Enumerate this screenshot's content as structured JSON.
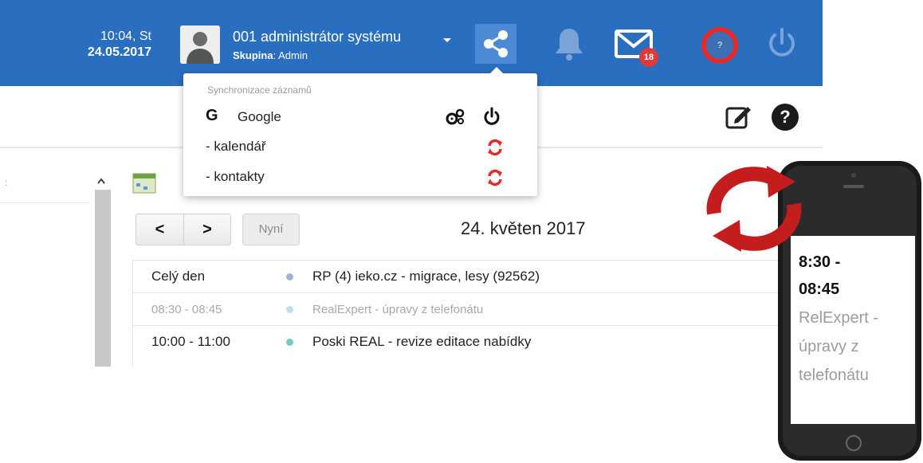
{
  "header": {
    "time": "10:04, St",
    "date": "24.05.2017",
    "user_name": "001 administrátor systému",
    "group_label": "Skupina",
    "group_value": ": Admin",
    "mail_count": "18",
    "help_glyph": "?",
    "icons": [
      "avatar",
      "chevron-down-icon",
      "share-icon",
      "bell-icon",
      "mail-icon",
      "help-icon",
      "power-icon"
    ]
  },
  "toolbar": {
    "icons": [
      "edit-icon",
      "question-circle-icon"
    ],
    "help_glyph": "?"
  },
  "sync_menu": {
    "heading": "Synchronizace záznamů",
    "provider_letter": "G",
    "provider_name": "Google",
    "items": [
      {
        "label": "- kalendář"
      },
      {
        "label": "- kontakty"
      }
    ],
    "accent_color": "#e52a2a"
  },
  "calendar": {
    "prev_label": "<",
    "next_label": ">",
    "now_label": "Nyní",
    "current_date": "24. květen 2017",
    "events": [
      {
        "time": "Celý den",
        "title": "RP (4) ieko.cz - migrace, lesy (92562)",
        "dot_color": "#9bb3d6"
      },
      {
        "time": "08:30 - 08:45",
        "title": "RealExpert - úpravy z telefonátu",
        "dot_color": "#b9e1e6"
      },
      {
        "time": "10:00 - 11:00",
        "title": "Poski REAL - revize editace nabídky",
        "dot_color": "#72c9c9"
      }
    ]
  },
  "phone": {
    "time_line1": "8:30 -",
    "time_line2": "08:45",
    "text_line1": "RelExpert -",
    "text_line2": "úpravy z",
    "text_line3": "telefonátu"
  },
  "colors": {
    "header_bg": "#2a6ec0",
    "share_bg": "#4d8ad6",
    "badge": "#e23838",
    "sync_red": "#e52a2a"
  }
}
